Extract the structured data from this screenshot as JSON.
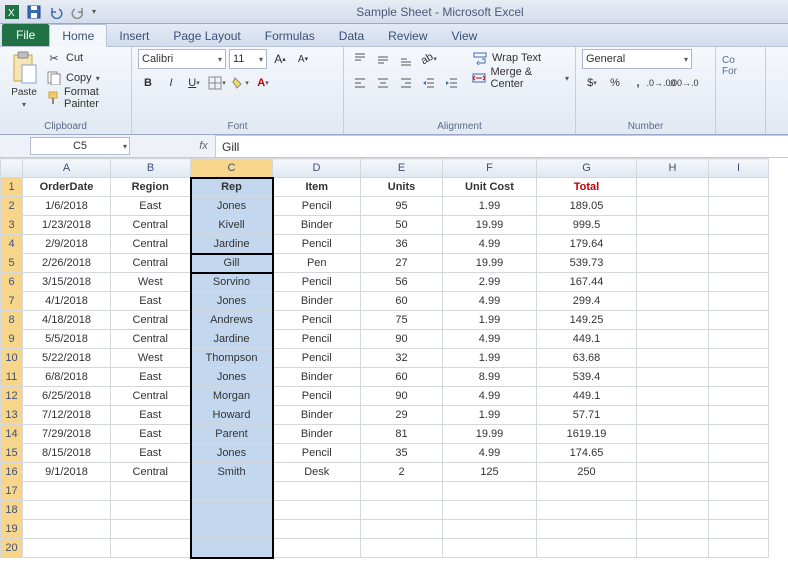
{
  "titlebar": {
    "title": "Sample Sheet  -  Microsoft Excel"
  },
  "tabs": {
    "file": "File",
    "items": [
      "Home",
      "Insert",
      "Page Layout",
      "Formulas",
      "Data",
      "Review",
      "View"
    ],
    "active": "Home"
  },
  "ribbon": {
    "clipboard": {
      "paste": "Paste",
      "cut": "Cut",
      "copy": "Copy",
      "formatpainter": "Format Painter",
      "label": "Clipboard"
    },
    "font": {
      "name": "Calibri",
      "size": "11",
      "label": "Font"
    },
    "alignment": {
      "wrap": "Wrap Text",
      "merge": "Merge & Center",
      "label": "Alignment"
    },
    "number": {
      "format": "General",
      "label": "Number"
    }
  },
  "namebox": "C5",
  "formula": "Gill",
  "columns": [
    "A",
    "B",
    "C",
    "D",
    "E",
    "F",
    "G",
    "H",
    "I"
  ],
  "headers": [
    "OrderDate",
    "Region",
    "Rep",
    "Item",
    "Units",
    "Unit Cost",
    "Total"
  ],
  "rows": [
    {
      "n": 1
    },
    {
      "n": 2,
      "d": [
        "1/6/2018",
        "East",
        "Jones",
        "Pencil",
        "95",
        "1.99",
        "189.05"
      ]
    },
    {
      "n": 3,
      "d": [
        "1/23/2018",
        "Central",
        "Kivell",
        "Binder",
        "50",
        "19.99",
        "999.5"
      ]
    },
    {
      "n": 4,
      "d": [
        "2/9/2018",
        "Central",
        "Jardine",
        "Pencil",
        "36",
        "4.99",
        "179.64"
      ]
    },
    {
      "n": 5,
      "d": [
        "2/26/2018",
        "Central",
        "Gill",
        "Pen",
        "27",
        "19.99",
        "539.73"
      ]
    },
    {
      "n": 6,
      "d": [
        "3/15/2018",
        "West",
        "Sorvino",
        "Pencil",
        "56",
        "2.99",
        "167.44"
      ]
    },
    {
      "n": 7,
      "d": [
        "4/1/2018",
        "East",
        "Jones",
        "Binder",
        "60",
        "4.99",
        "299.4"
      ]
    },
    {
      "n": 8,
      "d": [
        "4/18/2018",
        "Central",
        "Andrews",
        "Pencil",
        "75",
        "1.99",
        "149.25"
      ]
    },
    {
      "n": 9,
      "d": [
        "5/5/2018",
        "Central",
        "Jardine",
        "Pencil",
        "90",
        "4.99",
        "449.1"
      ]
    },
    {
      "n": 10,
      "d": [
        "5/22/2018",
        "West",
        "Thompson",
        "Pencil",
        "32",
        "1.99",
        "63.68"
      ]
    },
    {
      "n": 11,
      "d": [
        "6/8/2018",
        "East",
        "Jones",
        "Binder",
        "60",
        "8.99",
        "539.4"
      ]
    },
    {
      "n": 12,
      "d": [
        "6/25/2018",
        "Central",
        "Morgan",
        "Pencil",
        "90",
        "4.99",
        "449.1"
      ]
    },
    {
      "n": 13,
      "d": [
        "7/12/2018",
        "East",
        "Howard",
        "Binder",
        "29",
        "1.99",
        "57.71"
      ]
    },
    {
      "n": 14,
      "d": [
        "7/29/2018",
        "East",
        "Parent",
        "Binder",
        "81",
        "19.99",
        "1619.19"
      ]
    },
    {
      "n": 15,
      "d": [
        "8/15/2018",
        "East",
        "Jones",
        "Pencil",
        "35",
        "4.99",
        "174.65"
      ]
    },
    {
      "n": 16,
      "d": [
        "9/1/2018",
        "Central",
        "Smith",
        "Desk",
        "2",
        "125",
        "250"
      ]
    },
    {
      "n": 17
    },
    {
      "n": 18
    },
    {
      "n": 19
    },
    {
      "n": 20
    }
  ],
  "active_cell": {
    "row": 5,
    "col": 2
  },
  "selected_col": 2
}
